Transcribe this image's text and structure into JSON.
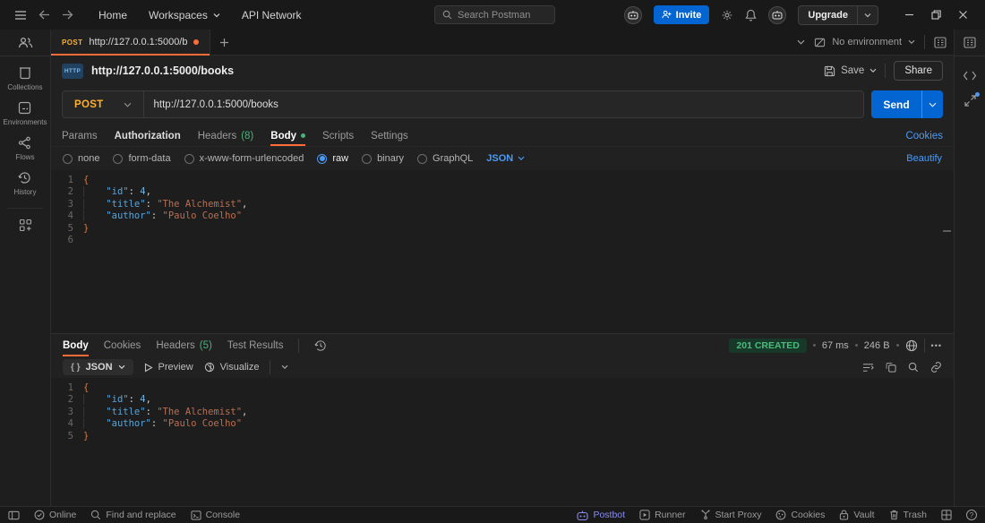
{
  "header": {
    "home": "Home",
    "workspaces": "Workspaces",
    "api_network": "API Network",
    "search_placeholder": "Search Postman",
    "invite": "Invite",
    "upgrade": "Upgrade"
  },
  "left_rail": {
    "collections": "Collections",
    "environments": "Environments",
    "flows": "Flows",
    "history": "History"
  },
  "tabstrip": {
    "method": "POST",
    "title": "http://127.0.0.1:5000/b",
    "environment": "No environment"
  },
  "request_header": {
    "badge": "HTTP",
    "title": "http://127.0.0.1:5000/books",
    "save": "Save",
    "share": "Share"
  },
  "url_bar": {
    "method": "POST",
    "url": "http://127.0.0.1:5000/books",
    "send": "Send"
  },
  "req_tabs": {
    "params": "Params",
    "authorization": "Authorization",
    "headers": "Headers",
    "headers_count": "(8)",
    "body": "Body",
    "scripts": "Scripts",
    "settings": "Settings",
    "cookies_link": "Cookies"
  },
  "body_modes": {
    "none": "none",
    "form_data": "form-data",
    "urlencoded": "x-www-form-urlencoded",
    "raw": "raw",
    "binary": "binary",
    "graphql": "GraphQL",
    "raw_type": "JSON",
    "beautify": "Beautify"
  },
  "request_body": {
    "lines": [
      [
        [
          "b",
          "{"
        ]
      ],
      [
        [
          "w",
          "    "
        ],
        [
          "k",
          "\"id\""
        ],
        [
          "p",
          ": "
        ],
        [
          "n",
          "4"
        ],
        [
          "p",
          ","
        ]
      ],
      [
        [
          "w",
          "    "
        ],
        [
          "k",
          "\"title\""
        ],
        [
          "p",
          ": "
        ],
        [
          "s",
          "\"The Alchemist\""
        ],
        [
          "p",
          ","
        ]
      ],
      [
        [
          "w",
          "    "
        ],
        [
          "k",
          "\"author\""
        ],
        [
          "p",
          ": "
        ],
        [
          "s",
          "\"Paulo Coelho\""
        ]
      ],
      [
        [
          "b",
          "}"
        ]
      ],
      []
    ]
  },
  "response": {
    "tabs": {
      "body": "Body",
      "cookies": "Cookies",
      "headers": "Headers",
      "headers_count": "(5)",
      "tests": "Test Results"
    },
    "status": "201 CREATED",
    "time": "67 ms",
    "size": "246 B",
    "format": "JSON",
    "preview": "Preview",
    "visualize": "Visualize"
  },
  "response_body": {
    "lines": [
      [
        [
          "b",
          "{"
        ]
      ],
      [
        [
          "w",
          "    "
        ],
        [
          "k",
          "\"id\""
        ],
        [
          "p",
          ": "
        ],
        [
          "n",
          "4"
        ],
        [
          "p",
          ","
        ]
      ],
      [
        [
          "w",
          "    "
        ],
        [
          "k",
          "\"title\""
        ],
        [
          "p",
          ": "
        ],
        [
          "s",
          "\"The Alchemist\""
        ],
        [
          "p",
          ","
        ]
      ],
      [
        [
          "w",
          "    "
        ],
        [
          "k",
          "\"author\""
        ],
        [
          "p",
          ": "
        ],
        [
          "s",
          "\"Paulo Coelho\""
        ]
      ],
      [
        [
          "b",
          "}"
        ]
      ]
    ]
  },
  "statusbar": {
    "online": "Online",
    "find": "Find and replace",
    "console": "Console",
    "postbot": "Postbot",
    "runner": "Runner",
    "proxy": "Start Proxy",
    "cookies": "Cookies",
    "vault": "Vault",
    "trash": "Trash"
  },
  "icons": {
    "ellipsis_glyph": "•••",
    "help_glyph": "?",
    "braces_glyph": "{ }"
  }
}
